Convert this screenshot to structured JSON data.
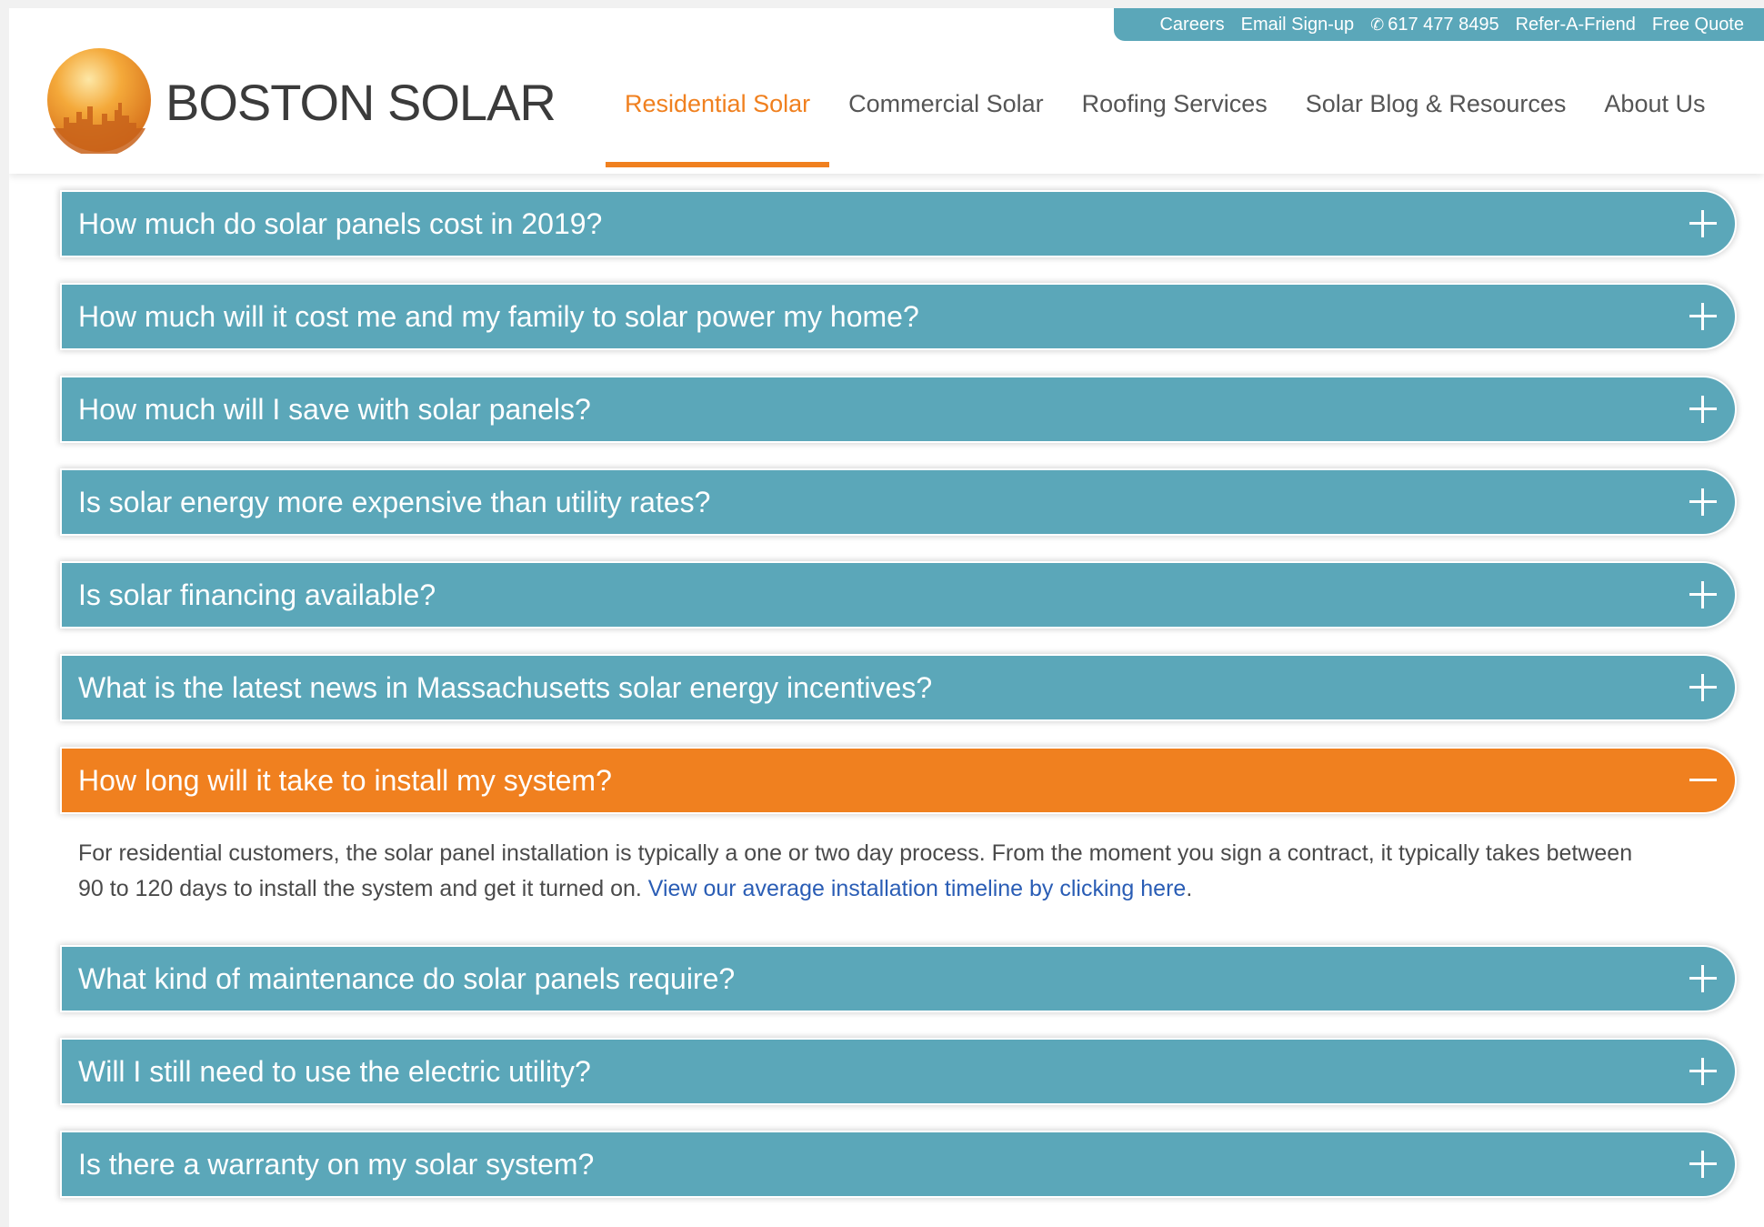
{
  "utility_nav": {
    "careers": "Careers",
    "email_signup": "Email Sign-up",
    "phone": "617 477 8495",
    "refer": "Refer-A-Friend",
    "quote": "Free Quote"
  },
  "brand": {
    "name": "BOSTON SOLAR"
  },
  "main_nav": [
    {
      "label": "Residential Solar",
      "active": true
    },
    {
      "label": "Commercial Solar",
      "active": false
    },
    {
      "label": "Roofing Services",
      "active": false
    },
    {
      "label": "Solar Blog & Resources",
      "active": false
    },
    {
      "label": "About Us",
      "active": false
    }
  ],
  "faq": [
    {
      "question": "How much do solar panels cost in 2019?",
      "open": false
    },
    {
      "question": "How much will it cost me and my family to solar power my home?",
      "open": false
    },
    {
      "question": "How much will I save with solar panels?",
      "open": false
    },
    {
      "question": "Is solar energy more expensive than utility rates?",
      "open": false
    },
    {
      "question": "Is solar financing available?",
      "open": false
    },
    {
      "question": "What is the latest news in Massachusetts solar energy incentives?",
      "open": false
    },
    {
      "question": "How long will it take to install my system?",
      "open": true,
      "answer": "For residential customers, the solar panel installation is typically a one or two day process. From the moment you sign a contract, it typically takes between 90 to 120 days to install the system and get it turned on. ",
      "answer_link": "View our average installation timeline by clicking here",
      "answer_end": "."
    },
    {
      "question": "What kind of maintenance do solar panels require?",
      "open": false
    },
    {
      "question": "Will I still need to use the electric utility?",
      "open": false
    },
    {
      "question": "Is there a warranty on my solar system?",
      "open": false
    }
  ],
  "colors": {
    "teal": "#5ba7b9",
    "orange": "#f0801f",
    "link_blue": "#2a5db5"
  },
  "icons": {
    "collapsed": "plus-icon",
    "expanded": "minus-icon",
    "phone": "phone-icon"
  }
}
